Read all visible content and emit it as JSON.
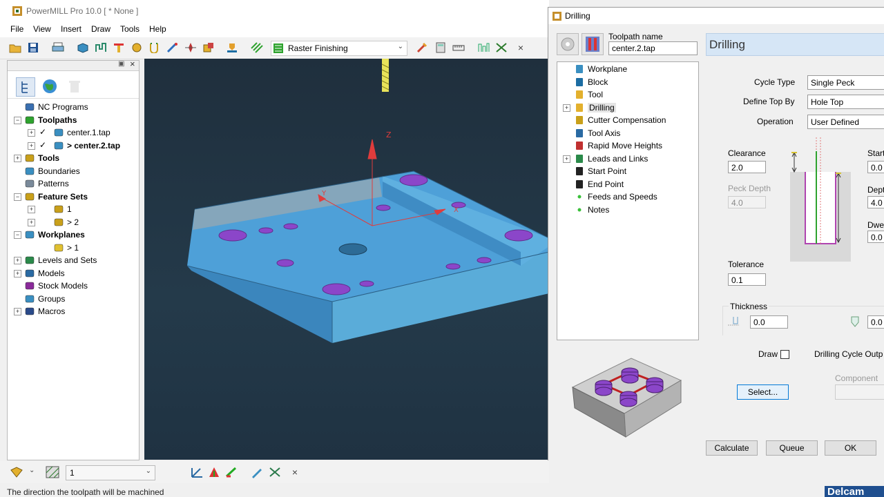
{
  "app": {
    "title": "PowerMILL Pro 10.0    [  * None ]",
    "menus": [
      "File",
      "View",
      "Insert",
      "Draw",
      "Tools",
      "Help"
    ],
    "strategy_selector": "Raster Finishing"
  },
  "explorer": {
    "items": [
      {
        "label": "NC Programs",
        "bold": false,
        "indent": 1,
        "icon": "nc-programs-icon"
      },
      {
        "label": "Toolpaths",
        "bold": true,
        "indent": 1,
        "icon": "toolpaths-icon"
      },
      {
        "label": "center.1.tap",
        "bold": false,
        "indent": 3,
        "icon": "toolpath-item-icon"
      },
      {
        "label": "> center.2.tap",
        "bold": true,
        "indent": 3,
        "icon": "toolpath-item-icon"
      },
      {
        "label": "Tools",
        "bold": true,
        "indent": 1,
        "icon": "tools-icon"
      },
      {
        "label": "Boundaries",
        "bold": false,
        "indent": 1,
        "icon": "boundaries-icon"
      },
      {
        "label": "Patterns",
        "bold": false,
        "indent": 1,
        "icon": "patterns-icon"
      },
      {
        "label": "Feature Sets",
        "bold": true,
        "indent": 1,
        "icon": "feature-sets-icon"
      },
      {
        "label": "1",
        "bold": false,
        "indent": 3,
        "icon": "feature-set-item-icon"
      },
      {
        "label": "> 2",
        "bold": false,
        "indent": 3,
        "icon": "feature-set-item-icon"
      },
      {
        "label": "Workplanes",
        "bold": true,
        "indent": 1,
        "icon": "workplanes-icon"
      },
      {
        "label": "> 1",
        "bold": false,
        "indent": 3,
        "icon": "workplane-item-icon"
      },
      {
        "label": "Levels and Sets",
        "bold": false,
        "indent": 1,
        "icon": "levels-icon"
      },
      {
        "label": "Models",
        "bold": false,
        "indent": 1,
        "icon": "models-icon"
      },
      {
        "label": "Stock Models",
        "bold": false,
        "indent": 1,
        "icon": "stock-models-icon"
      },
      {
        "label": "Groups",
        "bold": false,
        "indent": 1,
        "icon": "groups-icon"
      },
      {
        "label": "Macros",
        "bold": false,
        "indent": 1,
        "icon": "macros-icon"
      }
    ]
  },
  "bottom_toolbar": {
    "level_value": "1"
  },
  "status_bar": {
    "text": "The direction the toolpath will be machined"
  },
  "brand": {
    "text": "Delcam"
  },
  "dialog": {
    "title": "Drilling",
    "toolpath_name_label": "Toolpath name",
    "toolpath_name_value": "center.2.tap",
    "header": "Drilling",
    "tree": [
      {
        "label": "Workplane",
        "icon": "workplane-icon",
        "expander": false
      },
      {
        "label": "Block",
        "icon": "block-icon",
        "expander": false
      },
      {
        "label": "Tool",
        "icon": "tool-icon",
        "expander": false
      },
      {
        "label": "Drilling",
        "icon": "drilling-icon",
        "expander": true,
        "selected": true
      },
      {
        "label": "Cutter Compensation",
        "icon": "cutter-compensation-icon",
        "expander": false
      },
      {
        "label": "Tool Axis",
        "icon": "tool-axis-icon",
        "expander": false
      },
      {
        "label": "Rapid Move Heights",
        "icon": "rapid-move-icon",
        "expander": false
      },
      {
        "label": "Leads and Links",
        "icon": "leads-links-icon",
        "expander": true
      },
      {
        "label": "Start Point",
        "icon": "start-point-icon",
        "expander": false
      },
      {
        "label": "End Point",
        "icon": "end-point-icon",
        "expander": false
      },
      {
        "label": "Feeds and Speeds",
        "icon": "dot-icon",
        "expander": false
      },
      {
        "label": "Notes",
        "icon": "dot-icon",
        "expander": false
      }
    ],
    "cycle_type_label": "Cycle Type",
    "cycle_type_value": "Single Peck",
    "define_top_label": "Define Top By",
    "define_top_value": "Hole Top",
    "operation_label": "Operation",
    "operation_value": "User Defined",
    "clearance_label": "Clearance",
    "clearance_value": "2.0",
    "peck_depth_label": "Peck Depth",
    "peck_depth_value": "4.0",
    "tolerance_label": "Tolerance",
    "tolerance_value": "0.1",
    "thickness_label": "Thickness",
    "thickness_value": "0.0",
    "thickness_value_2": "0.0",
    "start_label": "Start",
    "start_value": "0.0",
    "depth_label": "Dept",
    "depth_value": "4.0",
    "dwell_label": "Dwe",
    "dwell_value": "0.0",
    "draw_label": "Draw",
    "drilling_cycle_output_label": "Drilling Cycle Outp",
    "component_label": "Component",
    "select_button": "Select...",
    "calculate_button": "Calculate",
    "queue_button": "Queue",
    "ok_button": "OK"
  }
}
